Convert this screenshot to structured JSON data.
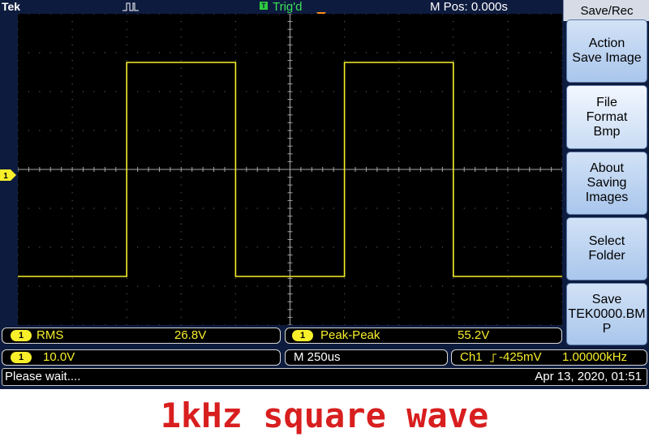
{
  "topbar": {
    "brand": "Tek",
    "trigger_indicator": "T",
    "trigger_status": "Trig'd",
    "position": "M Pos: 0.000s",
    "acquisition_icon": "pulse-icon",
    "trigger_position_icon": "trigger-position-marker-icon"
  },
  "channel_marker": "1",
  "menu": {
    "title": "Save/Rec",
    "buttons": [
      {
        "label": "Action\nSave Image"
      },
      {
        "label": "File\nFormat\nBmp"
      },
      {
        "label": "About\nSaving\nImages"
      },
      {
        "label": "Select\nFolder"
      },
      {
        "label": "Save\nTEK0000.BM\nP"
      }
    ]
  },
  "measurements": [
    {
      "channel": "1",
      "name": "RMS",
      "value": "26.8V"
    },
    {
      "channel": "1",
      "name": "Peak-Peak",
      "value": "55.2V"
    }
  ],
  "settings": {
    "channel": "1",
    "vertical_scale": "10.0V",
    "timebase": "M 250us",
    "trigger_source": "Ch1",
    "trigger_slope_icon": "rising-edge-icon",
    "trigger_level": "-425mV",
    "frequency": "1.00000kHz"
  },
  "status": {
    "message": "Please wait....",
    "datetime": "Apr 13, 2020, 01:51"
  },
  "caption": "1kHz square wave",
  "colors": {
    "background": "#0d1b3e",
    "trace": "#f7ef2a",
    "trigger": "#ff8c1a",
    "trig_status": "#3ee05a",
    "caption": "#d81e1e"
  },
  "chart_data": {
    "type": "line",
    "x_unit": "us",
    "y_unit": "V",
    "x_per_division_us": 250,
    "y_per_division_V": 10,
    "series": [
      {
        "x": [
          -1250,
          -750,
          -750,
          -250,
          -250,
          250,
          250,
          750,
          750,
          1250
        ],
        "y": [
          -27.5,
          -27.5,
          27.5,
          27.5,
          -27.5,
          -27.5,
          27.5,
          27.5,
          -27.5,
          -27.5
        ]
      }
    ],
    "xlim": [
      -1250,
      1250
    ],
    "ylim": [
      -40,
      40
    ],
    "grid": true
  }
}
